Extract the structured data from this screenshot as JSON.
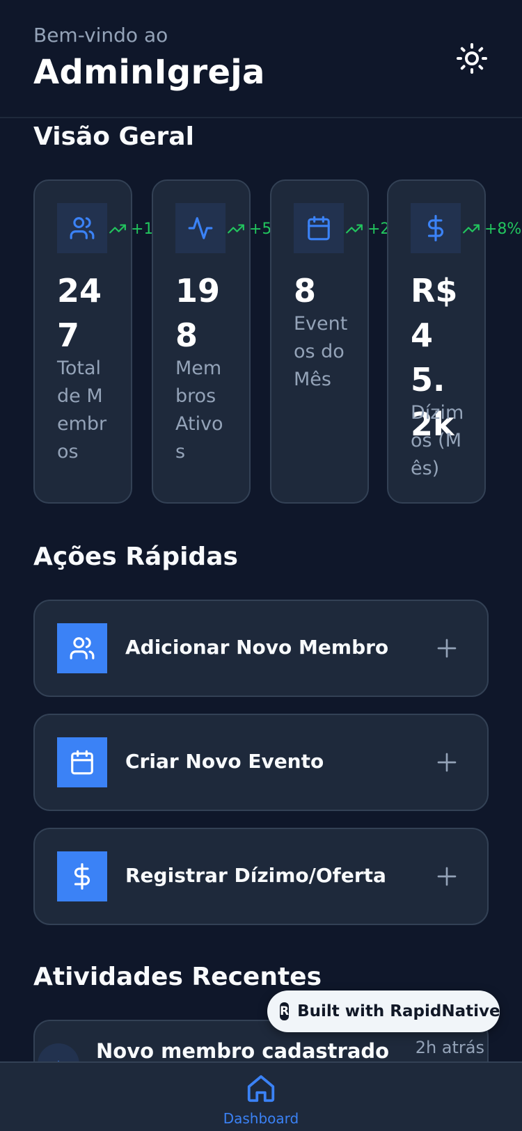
{
  "header": {
    "welcome_text": "Bem-vindo ao",
    "app_title": "AdminIgreja"
  },
  "overview": {
    "title": "Visão Geral",
    "stats": [
      {
        "icon": "users-icon",
        "trend": "+1",
        "value": "247",
        "label": "Total de Membros"
      },
      {
        "icon": "activity-icon",
        "trend": "+5",
        "value": "198",
        "label": "Membros Ativos"
      },
      {
        "icon": "calendar-icon",
        "trend": "+2",
        "value": "8",
        "label": "Eventos do Mês"
      },
      {
        "icon": "dollar-icon",
        "trend": "+8%",
        "value": "R$ 45.2k",
        "label": "Dízimos (Mês)"
      }
    ]
  },
  "quick_actions": {
    "title": "Ações Rápidas",
    "items": [
      {
        "icon": "users-icon",
        "label": "Adicionar Novo Membro"
      },
      {
        "icon": "calendar-icon",
        "label": "Criar Novo Evento"
      },
      {
        "icon": "dollar-icon",
        "label": "Registrar Dízimo/Oferta"
      }
    ]
  },
  "recent": {
    "title": "Atividades Recentes",
    "items": [
      {
        "title": "Novo membro cadastrado",
        "time": "2h atrás"
      }
    ]
  },
  "badge": {
    "text": "Built with RapidNative"
  },
  "tabbar": {
    "dashboard_label": "Dashboard"
  },
  "colors": {
    "background": "#0f172a",
    "card": "#1e293b",
    "border": "#334155",
    "accent": "#3b82f6",
    "trend_positive": "#22c55e",
    "muted_text": "#94a3b8"
  }
}
